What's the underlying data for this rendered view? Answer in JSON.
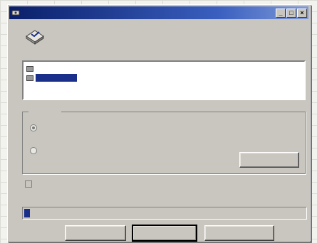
{
  "window": {
    "title": "",
    "buttons": {
      "minimize": "_",
      "maximize": "□",
      "close": "×"
    },
    "accent_color": "#1a2f8a"
  },
  "prompt": {
    "text": ""
  },
  "disk_list": {
    "items": [
      {
        "label": "",
        "selected": false
      },
      {
        "label": "",
        "selected": true
      }
    ]
  },
  "check_group": {
    "title": "",
    "options": [
      {
        "label": "",
        "description": "",
        "checked": true
      },
      {
        "label": "",
        "description": "",
        "checked": false
      }
    ],
    "settings_button": ""
  },
  "auto_fix": {
    "label": "",
    "checked": true
  },
  "status": {
    "text": ""
  },
  "progress": {
    "fraction": 0.02
  },
  "buttons": {
    "start": "",
    "cancel": "",
    "more": ""
  }
}
